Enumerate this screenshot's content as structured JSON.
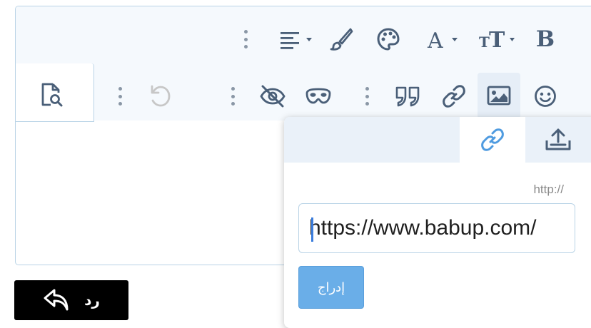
{
  "toolbar": {
    "bold_label": "B",
    "icons_row1": [
      "bold-icon",
      "text-size-icon",
      "font-color-icon",
      "palette-icon",
      "brush-icon",
      "align-icon",
      "more-vertical-icon"
    ],
    "icons_row2": [
      "smiley-icon",
      "image-icon",
      "link-icon",
      "quote-icon",
      "more-vertical-icon",
      "mask-icon",
      "eye-off-icon",
      "more-vertical-icon",
      "undo-icon",
      "more-vertical-icon",
      "preview-icon"
    ]
  },
  "popup": {
    "tabs": [
      {
        "name": "link",
        "icon": "link-icon",
        "active": true
      },
      {
        "name": "upload",
        "icon": "upload-icon",
        "active": false
      }
    ],
    "hint": "http://",
    "url_value": "https://www.babup.com/",
    "insert_label": "إدراج"
  },
  "reply": {
    "label": "رد"
  },
  "colors": {
    "accent": "#6aaee8",
    "border": "#b9d3e6",
    "toolbar_bg": "#f5f9fd",
    "icon": "#4a5f78"
  }
}
